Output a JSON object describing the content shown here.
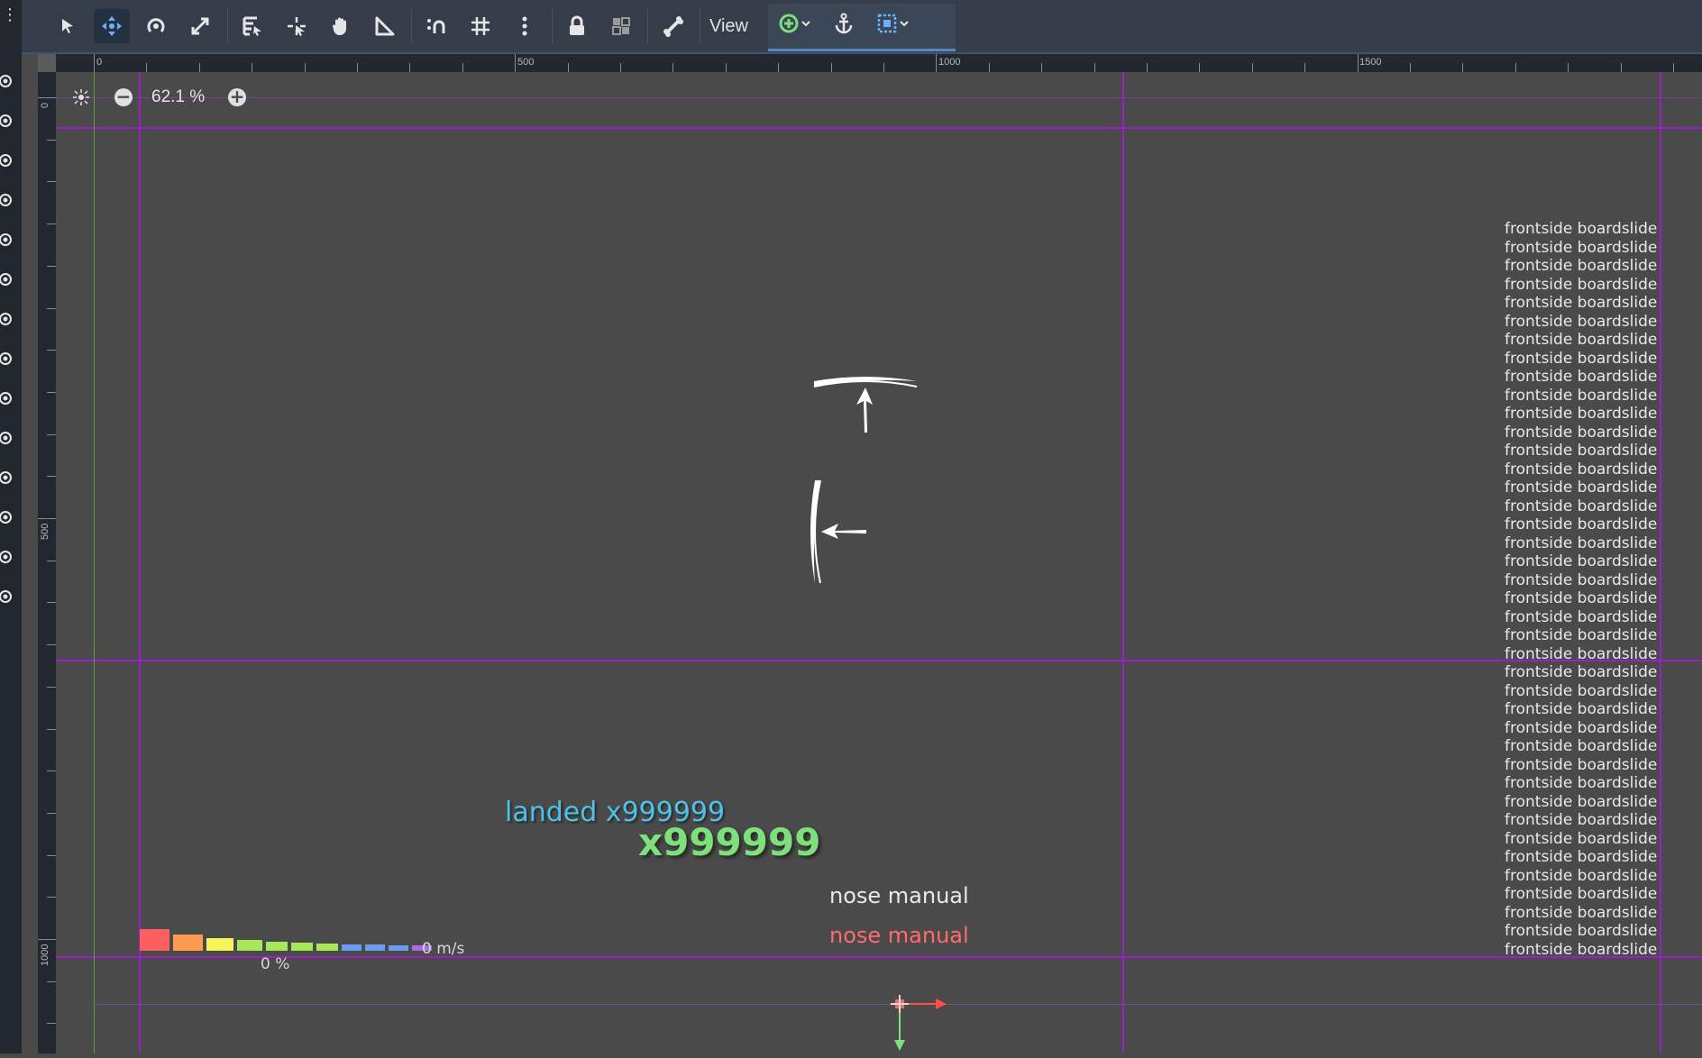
{
  "toolbar": {
    "tools": [
      {
        "name": "select-mode",
        "icon": "arrow-cursor-icon"
      },
      {
        "name": "move-mode",
        "icon": "move-icon"
      },
      {
        "name": "rotate-mode",
        "icon": "rotate-icon"
      },
      {
        "name": "scale-mode",
        "icon": "scale-icon"
      },
      {
        "name": "list-select",
        "icon": "list-select-icon"
      },
      {
        "name": "pivot-mode",
        "icon": "pivot-icon"
      },
      {
        "name": "pan-mode",
        "icon": "hand-icon"
      },
      {
        "name": "ruler-mode",
        "icon": "ruler-icon"
      },
      {
        "name": "smart-snap",
        "icon": "snap-icon"
      },
      {
        "name": "grid-snap",
        "icon": "grid-icon"
      },
      {
        "name": "more-options",
        "icon": "kebab-icon"
      },
      {
        "name": "lock",
        "icon": "lock-icon"
      },
      {
        "name": "group",
        "icon": "group-icon"
      },
      {
        "name": "bones",
        "icon": "bone-icon"
      }
    ],
    "view_label": "View"
  },
  "zoom": {
    "level": "62.1 %"
  },
  "ruler": {
    "h_labels": [
      "0",
      "500",
      "1000",
      "1500"
    ],
    "v_labels": [
      "0",
      "500",
      "1000"
    ]
  },
  "scene": {
    "trick_lines": [
      "frontside boardslide",
      "frontside boardslide",
      "frontside boardslide",
      "frontside boardslide",
      "frontside boardslide",
      "frontside boardslide",
      "frontside boardslide",
      "frontside boardslide",
      "frontside boardslide",
      "frontside boardslide",
      "frontside boardslide",
      "frontside boardslide",
      "frontside boardslide",
      "frontside boardslide",
      "frontside boardslide",
      "frontside boardslide",
      "frontside boardslide",
      "frontside boardslide",
      "frontside boardslide",
      "frontside boardslide",
      "frontside boardslide",
      "frontside boardslide",
      "frontside boardslide",
      "frontside boardslide",
      "frontside boardslide",
      "frontside boardslide",
      "frontside boardslide",
      "frontside boardslide",
      "frontside boardslide",
      "frontside boardslide",
      "frontside boardslide",
      "frontside boardslide",
      "frontside boardslide",
      "frontside boardslide",
      "frontside boardslide",
      "frontside boardslide",
      "frontside boardslide",
      "frontside boardslide",
      "frontside boardslide",
      "frontside boardslide"
    ],
    "landed_text": "landed x999999",
    "multiplier_text": "x999999",
    "trick_name_white": "nose manual",
    "trick_name_red": "nose manual",
    "speed_label": "0 m/s",
    "percent_label": "0 %",
    "speed_bar_colors": [
      "#ff5f5f",
      "#ff9a4f",
      "#f5f55a",
      "#a6e85a",
      "#a6e85a",
      "#a6e85a",
      "#a6e85a",
      "#6a9df2",
      "#6a9df2",
      "#6a9df2",
      "#a86ae6"
    ]
  },
  "colors": {
    "guide_line": "#9b1fc6",
    "landed": "#4fc1e6",
    "multiplier": "#7de07a",
    "trick_red": "#ff6b6b"
  }
}
